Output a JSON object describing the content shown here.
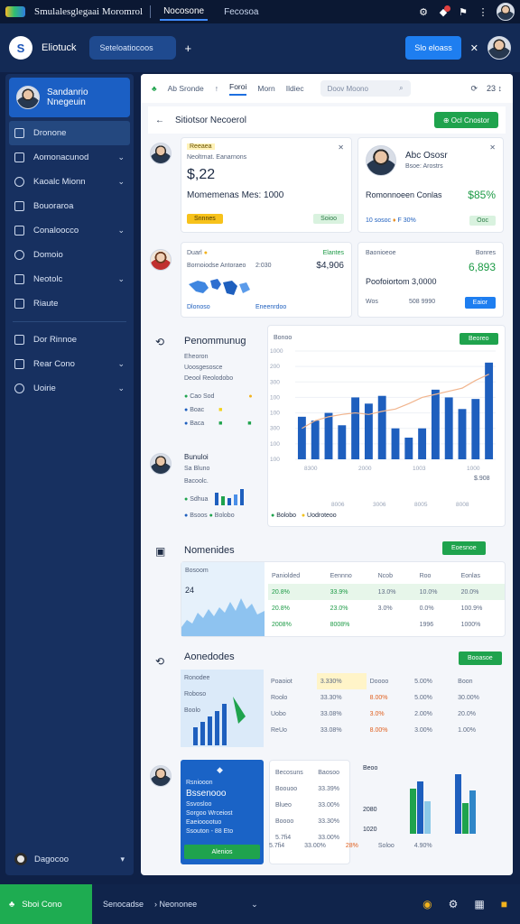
{
  "topbar": {
    "title": "Smulalesglegaai Moromrol",
    "tabs": [
      "Nocosone",
      "Fecosoa"
    ]
  },
  "subbar": {
    "brand": "Eliotuck",
    "search_placeholder": "Seteloatiocoos",
    "action_label": "Slo eloass"
  },
  "sidebar": {
    "profile_name": "Sandanrio Nnegeuin",
    "items": [
      {
        "label": "Dronone",
        "chevron": false,
        "active": true
      },
      {
        "label": "Aomonacunod",
        "chevron": true
      },
      {
        "label": "Kaoalc Mionn",
        "chevron": true
      },
      {
        "label": "Bouoraroa",
        "chevron": false
      },
      {
        "label": "Conaloocco",
        "chevron": true
      },
      {
        "label": "Domoio",
        "chevron": false
      },
      {
        "label": "Neotolc",
        "chevron": true
      },
      {
        "label": "Riaute",
        "chevron": false
      }
    ],
    "items2": [
      {
        "label": "Dor Rinnoe",
        "chevron": false
      },
      {
        "label": "Rear Cono",
        "chevron": true
      },
      {
        "label": "Uoirie",
        "chevron": true
      }
    ],
    "bottom_label": "Dagocoo"
  },
  "tabs": {
    "items": [
      "Ab Sronde",
      "Foroi",
      "Morn",
      "Ildiec"
    ],
    "search_placeholder": "Doov Moono",
    "tools_text": "23 ↕"
  },
  "crumb": {
    "title": "Sitiotsor Necoerol",
    "button": "Ocl Cnostor"
  },
  "card1": {
    "tag": "Reeaea",
    "meta": "Neoltrnat. Eanarnons",
    "value": "$,22",
    "subtitle": "Momemenas Mes: 1000",
    "chip_yellow": "Snnnes",
    "chip_green": "Soioo"
  },
  "card2": {
    "name": "Abc Ososr",
    "meta": "Bsoe: Arostrs",
    "subtitle": "Romonnoeen Conlas",
    "percent": "$85%",
    "meta2": "10 sosoc",
    "meta2_tail": "F 30%",
    "chip_green": "Ooc"
  },
  "card3": {
    "tag": "Duarl",
    "meta_right": "Elantes",
    "line1": "Bornoiodse Antoraeo",
    "line1_num": "2:030",
    "value": "$4,906",
    "legend1": "Dlonoso",
    "legend2": "Eneenrdoo"
  },
  "card4": {
    "tag": "Baonioeoe",
    "meta_right": "Bonres",
    "subtitle": "Poofoiortom 3,0000",
    "value": "6,893",
    "meta_left": "Wos",
    "meta_mid": "508 9990",
    "button": "Eaior"
  },
  "perf": {
    "title": "Penommunug",
    "sub1": "Eheoron",
    "sub2": "Uoosgesosce",
    "sub3": "Deool Reolodobo",
    "legend_rows": [
      "Cao Sod",
      "Boac",
      "Baca"
    ],
    "button": "Beoreo",
    "chart_label": "Bonoo",
    "side_label": "$.908"
  },
  "perf2": {
    "tag": "Bunuloi",
    "sub": "Sa Bluno",
    "meta": "Bacoolc.",
    "legend": [
      "Sdhua",
      "Bsoos"
    ],
    "legend_bottom": [
      "Bolobo",
      "Uodroteoo"
    ]
  },
  "chart_data": {
    "type": "bar",
    "categories": [
      "",
      "",
      "",
      "",
      "",
      "",
      "",
      "",
      "",
      "",
      "",
      "",
      "",
      "",
      ""
    ],
    "values": [
      55,
      50,
      60,
      44,
      80,
      72,
      82,
      40,
      28,
      40,
      90,
      80,
      65,
      78,
      125
    ],
    "series": [
      {
        "name": "",
        "values": [
          55,
          50,
          60,
          44,
          80,
          72,
          82,
          40,
          28,
          40,
          90,
          80,
          65,
          78,
          125
        ]
      }
    ],
    "line_values": [
      40,
      50,
      55,
      58,
      60,
      58,
      62,
      65,
      72,
      80,
      84,
      88,
      92,
      102,
      110
    ],
    "y_ticks": [
      "1000",
      "200",
      "300",
      "100",
      "100",
      "300",
      "100",
      "100"
    ],
    "x_labels": [
      "8300",
      "2000",
      "1003",
      "1000"
    ],
    "x_labels_bottom": [
      "8006",
      "3006",
      "8005",
      "8008"
    ],
    "colors": {
      "bar": "#1e5fbe",
      "line": "#f1b58e"
    }
  },
  "networks": {
    "title": "Nomenides",
    "button": "Eoesnoe",
    "headers": [
      "Paniolded",
      "Eennno",
      "Ncob",
      "Roo",
      "Eonlas"
    ],
    "mini_label": "Bosoom",
    "mini_value": "24",
    "rows": [
      [
        "20.8%",
        "33.9%",
        "13.0%",
        "10.0%",
        "20.0%"
      ],
      [
        "20.8%",
        "23.0%",
        "3.0%",
        "0.0%",
        "100.9%"
      ],
      [
        "2008%",
        "8008%",
        "",
        "1996",
        "1000%"
      ]
    ]
  },
  "accounts": {
    "title": "Aonedodes",
    "button": "Booasoe",
    "mini": [
      "Ronodee",
      "Roboso",
      "Boolo"
    ],
    "headers": [
      "Poaoiot",
      "3.330%",
      "Doooo",
      "5.00%",
      "Boon"
    ],
    "rows": [
      [
        "Roolo",
        "33.30%",
        "8.00%",
        "5.00%",
        "30.00%"
      ],
      [
        "Uobo",
        "33.08%",
        "3.0%",
        "2.00%",
        "20.0%"
      ],
      [
        "ReUo",
        "33.08%",
        "8.00%",
        "3.00%",
        "1.00%"
      ]
    ]
  },
  "promo": {
    "badge": "Rsniooon",
    "title": "Bssenooo",
    "lines": [
      "Ssvosloo",
      "Sorgoo Wrceiost",
      "Eaeiooootuo",
      "Ssouton - 88 Eto"
    ],
    "button": "Alenios"
  },
  "table2": {
    "headers": [
      "Becosuns",
      "Baosoo",
      "Beoo"
    ],
    "rows": [
      [
        "Boouoo",
        "33.39%",
        ""
      ],
      [
        "Blueo",
        "33.00%",
        "2080"
      ],
      [
        "Boooo",
        "33.30%",
        "1020"
      ],
      [
        "5.7fi4",
        "33.00%",
        "28%"
      ]
    ],
    "bottom": [
      "5.7fi4",
      "33.00%",
      "28%",
      "Soloo",
      "4.90%"
    ]
  },
  "bottombar": {
    "green_label": "Sboi Cono",
    "text1": "Senocadse",
    "text2": "Neononee"
  }
}
